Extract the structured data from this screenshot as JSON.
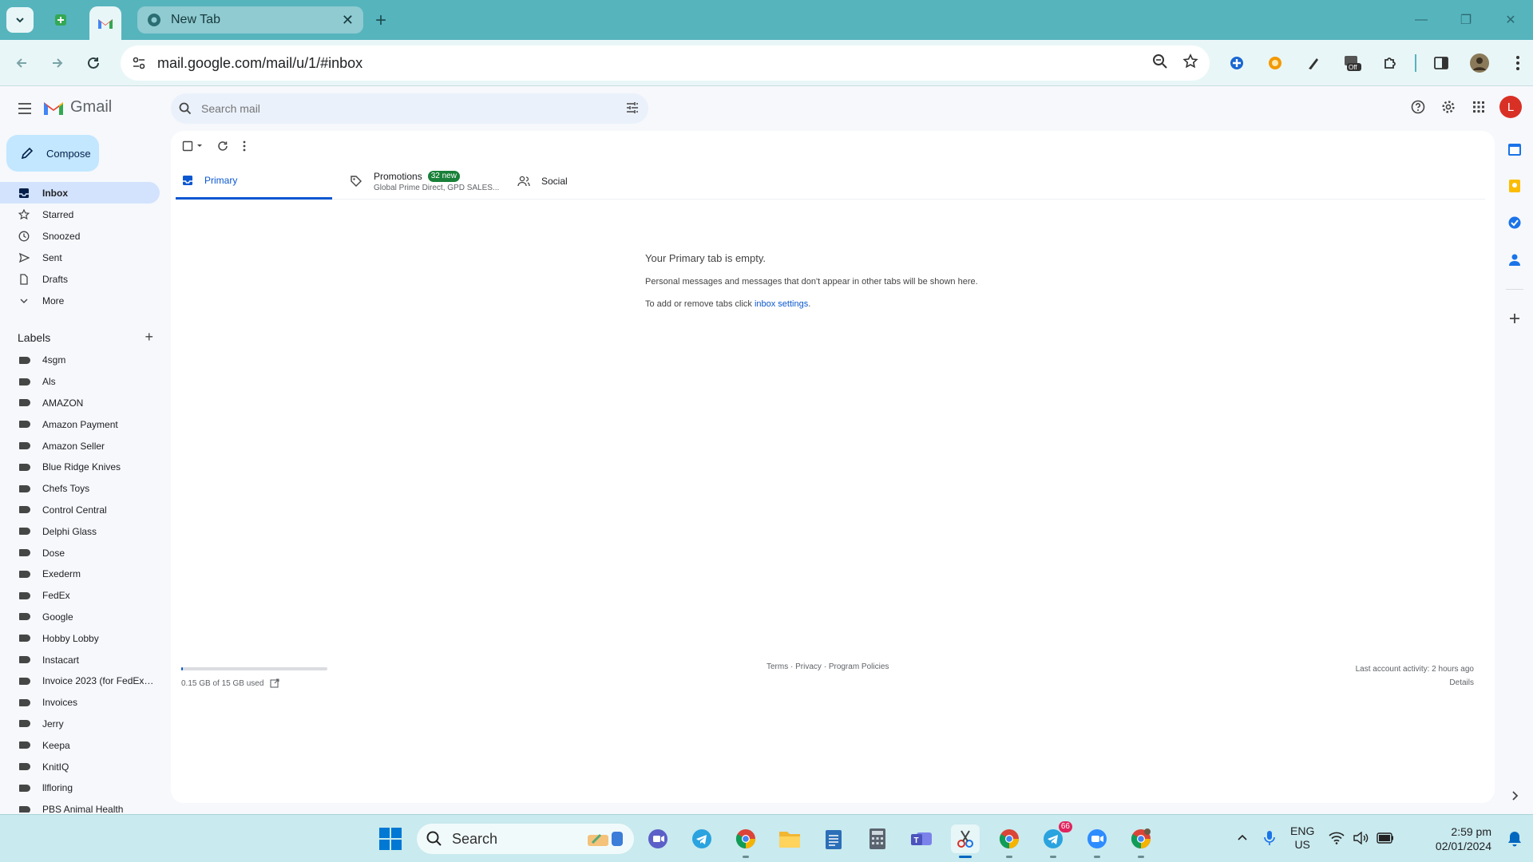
{
  "browser": {
    "tab_title": "New Tab",
    "url": "mail.google.com/mail/u/1/#inbox"
  },
  "gmail": {
    "app_name": "Gmail",
    "search_placeholder": "Search mail",
    "account_initial": "L",
    "compose_label": "Compose",
    "nav": [
      {
        "label": "Inbox",
        "icon": "inbox-icon",
        "active": true
      },
      {
        "label": "Starred",
        "icon": "star-icon"
      },
      {
        "label": "Snoozed",
        "icon": "clock-icon"
      },
      {
        "label": "Sent",
        "icon": "send-icon"
      },
      {
        "label": "Drafts",
        "icon": "draft-icon"
      },
      {
        "label": "More",
        "icon": "chevron-down-icon"
      }
    ],
    "labels_heading": "Labels",
    "labels": [
      "4sgm",
      "Als",
      "AMAZON",
      "Amazon Payment",
      "Amazon Seller",
      "Blue Ridge Knives",
      "Chefs Toys",
      "Control Central",
      "Delphi Glass",
      "Dose",
      "Exederm",
      "FedEx",
      "Google",
      "Hobby Lobby",
      "Instacart",
      "Invoice 2023 (for FedEx ...",
      "Invoices",
      "Jerry",
      "Keepa",
      "KnitIQ",
      "llfloring",
      "PBS Animal Health"
    ],
    "tabs": {
      "primary": "Primary",
      "promotions": "Promotions",
      "promotions_badge": "32 new",
      "promotions_sub": "Global Prime Direct, GPD SALES...",
      "social": "Social"
    },
    "empty": {
      "heading": "Your Primary tab is empty.",
      "line1": "Personal messages and messages that don't appear in other tabs will be shown here.",
      "line2_prefix": "To add or remove tabs click ",
      "line2_link": "inbox settings",
      "line2_suffix": "."
    },
    "footer": {
      "storage": "0.15 GB of 15 GB used",
      "storage_fraction": 0.01,
      "terms": "Terms",
      "privacy": "Privacy",
      "policies": "Program Policies",
      "sep": " · ",
      "last_activity": "Last account activity: 2 hours ago",
      "details": "Details"
    }
  },
  "taskbar": {
    "search_label": "Search",
    "telegram_badge": "66",
    "lang_line1": "ENG",
    "lang_line2": "US",
    "time": "2:59 pm",
    "date": "02/01/2024"
  },
  "colors": {
    "accent": "#0b57d0",
    "compose_bg": "#c2e7ff",
    "active_nav": "#d3e3fd",
    "chrome_frame": "#56b4bd"
  }
}
